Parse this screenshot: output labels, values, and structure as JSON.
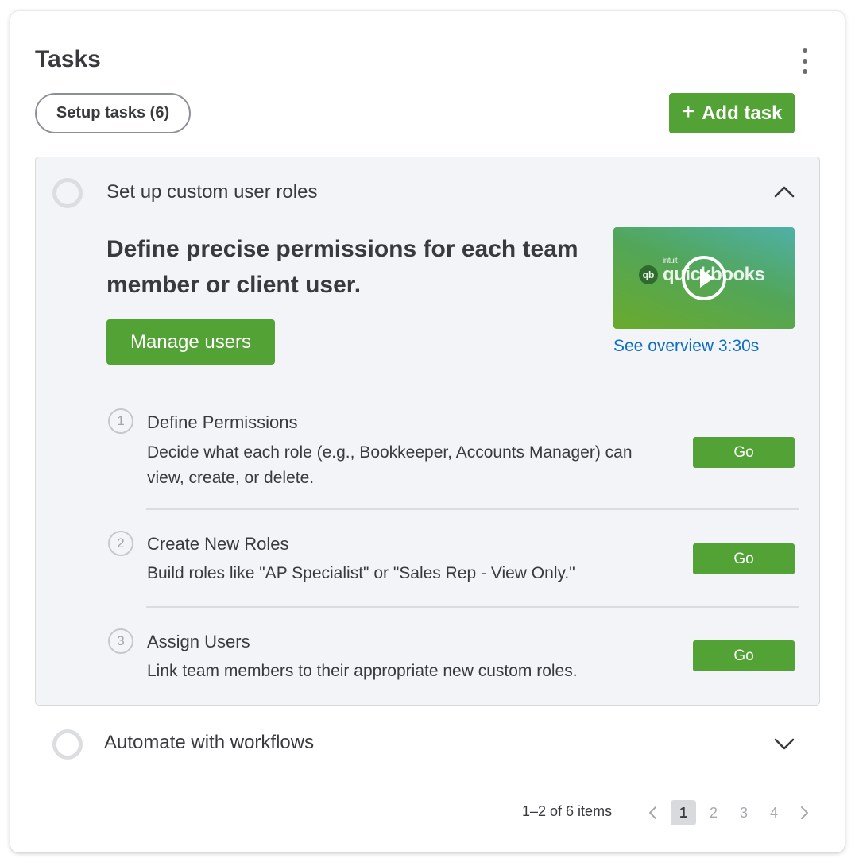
{
  "card": {
    "title": "Tasks",
    "menu_icon": "kebab-icon"
  },
  "filter": {
    "label": "Setup tasks (6)"
  },
  "add_task": {
    "icon": "plus-icon",
    "label": "Add task"
  },
  "tasks": [
    {
      "title": "Set up custom user roles",
      "expanded": true,
      "headline": "Define precise permissions for each team member or client user.",
      "primary_button": "Manage users",
      "video": {
        "brand_small": "intuit",
        "brand": "quickbooks",
        "mark": "qb",
        "link": "See overview 3:30s"
      },
      "steps": [
        {
          "number": "1",
          "title": "Define Permissions",
          "description": "Decide what each role (e.g., Bookkeeper, Accounts Manager) can view, create, or delete.",
          "button": "Go"
        },
        {
          "number": "2",
          "title": "Create New Roles",
          "description": "Build roles like \"AP Specialist\" or \"Sales Rep - View Only.\"",
          "button": "Go"
        },
        {
          "number": "3",
          "title": "Assign Users",
          "description": "Link team members to their appropriate new custom roles.",
          "button": "Go"
        }
      ]
    },
    {
      "title": "Automate with workflows",
      "expanded": false
    }
  ],
  "pagination": {
    "summary": "1–2 of 6 items",
    "pages": [
      "1",
      "2",
      "3",
      "4"
    ],
    "current": "1"
  },
  "colors": {
    "accent_green": "#53a236",
    "link_blue": "#0d6ec4",
    "text": "#393a3d"
  }
}
